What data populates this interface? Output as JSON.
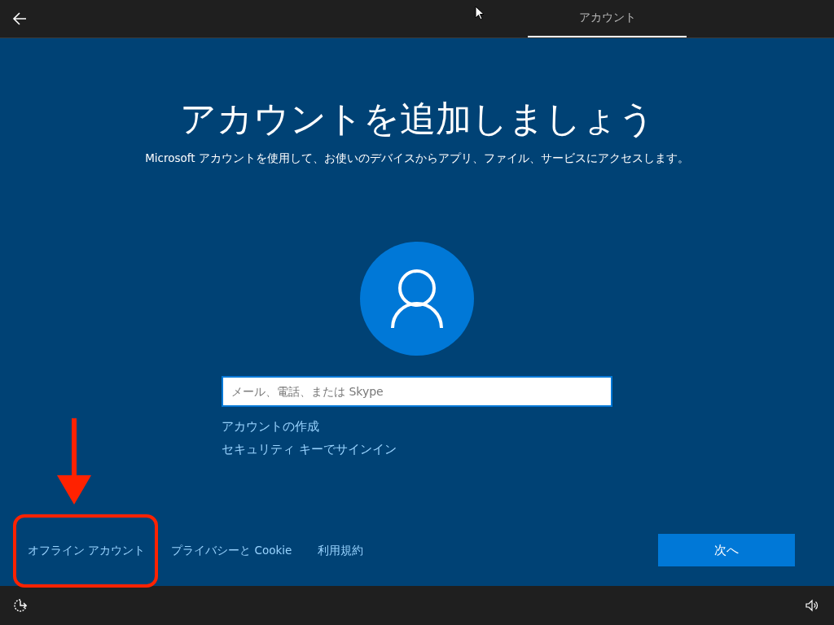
{
  "top_bar": {
    "tabs": [
      {
        "label": "アカウント",
        "selected": true
      }
    ]
  },
  "heading": "アカウントを追加しましょう",
  "subheading": "Microsoft アカウントを使用して、お使いのデバイスからアプリ、ファイル、サービスにアクセスします。",
  "email_field": {
    "placeholder": "メール、電話、または Skype"
  },
  "links": [
    "アカウントの作成",
    "セキュリティ キーでサインイン"
  ],
  "footer_links": [
    {
      "label": "オフライン アカウント",
      "highlighted": true
    },
    {
      "label": "プライバシーと Cookie",
      "highlighted": false
    },
    {
      "label": "利用規約",
      "highlighted": false
    }
  ],
  "next_button": {
    "label": "次へ"
  }
}
